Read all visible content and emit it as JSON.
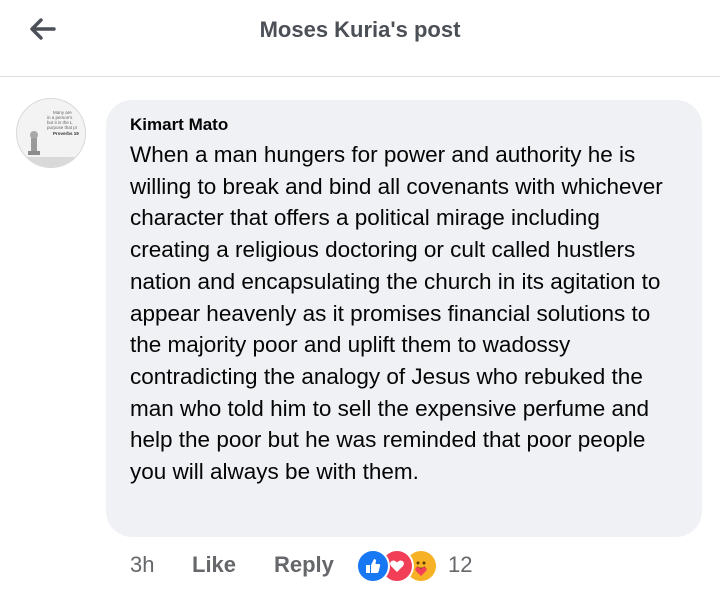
{
  "header": {
    "title": "Moses Kuria's post",
    "back_icon": "arrow-left-icon"
  },
  "comment": {
    "author": "Kimart Mato",
    "avatar_text": [
      "Many are",
      "in a person's",
      "but it is the L",
      "purpose that pr",
      "Proverbs 19"
    ],
    "text": "When a man hungers for power and authority he is willing to break and bind all covenants with whichever character that offers a political mirage including creating a religious doctoring or cult called hustlers nation and encapsulating the church in its agitation to appear heavenly as it promises financial solutions to the majority poor and uplift them to wadossy contradicting the analogy of Jesus who rebuked the man who told him to sell the expensive perfume and help the poor but he was reminded that poor people you will always be with them.",
    "time": "3h",
    "like_label": "Like",
    "reply_label": "Reply",
    "reaction_count": "12",
    "reactions": [
      "like-reaction-icon",
      "love-reaction-icon",
      "care-reaction-icon"
    ]
  },
  "colors": {
    "bubble": "#eff1f4",
    "like_blue": "#1877f2",
    "love_red": "#f33e58",
    "care_yellow": "#f7b125",
    "muted_text": "#65676b"
  }
}
